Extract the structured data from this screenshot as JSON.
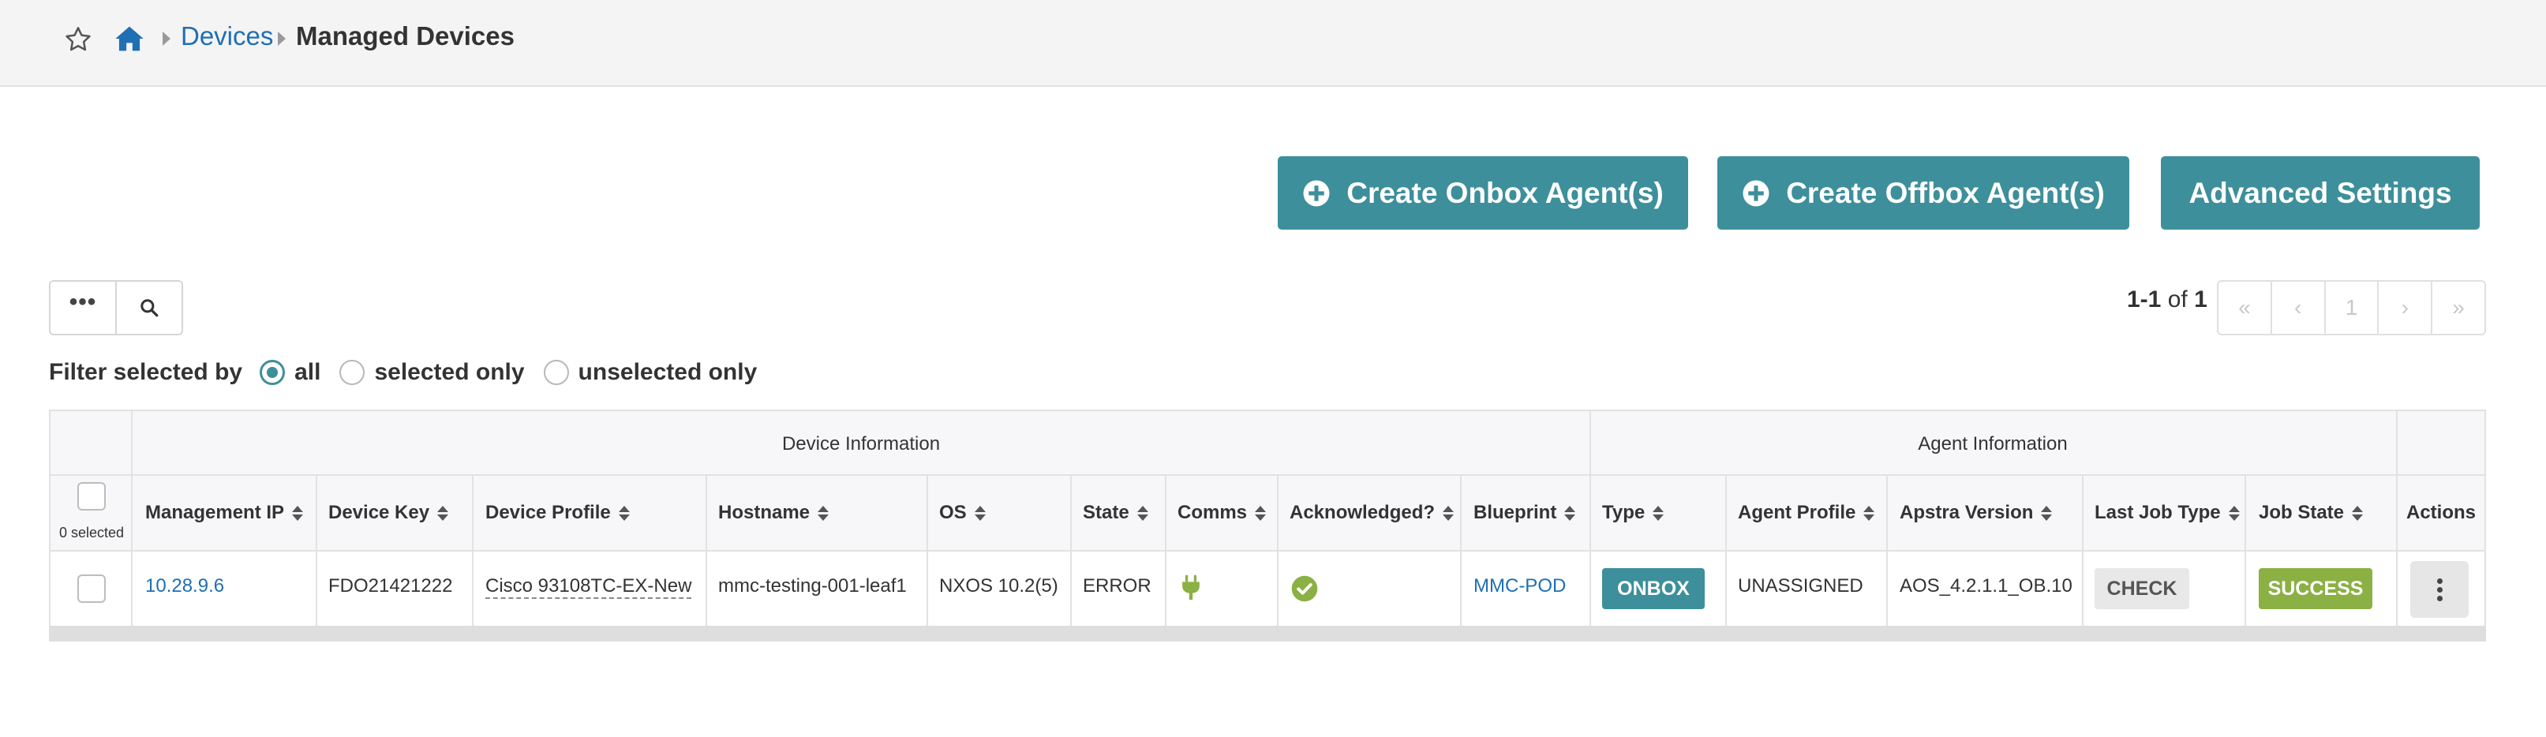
{
  "breadcrumb": {
    "devices": "Devices",
    "managed_devices": "Managed Devices"
  },
  "actions": {
    "create_onbox": "Create Onbox Agent(s)",
    "create_offbox": "Create Offbox Agent(s)",
    "advanced_settings": "Advanced Settings"
  },
  "toolbar": {
    "more": "•••"
  },
  "pagination": {
    "range": "1-1",
    "of": "of",
    "total": "1",
    "first": "«",
    "prev": "‹",
    "page": "1",
    "next": "›",
    "last": "»"
  },
  "filter": {
    "label": "Filter selected by",
    "options": [
      "all",
      "selected only",
      "unselected only"
    ],
    "selected": "all"
  },
  "table": {
    "groups": {
      "device_information": "Device Information",
      "agent_information": "Agent Information"
    },
    "selected_count": "0 selected",
    "columns": {
      "management_ip": "Management IP",
      "device_key": "Device Key",
      "device_profile": "Device Profile",
      "hostname": "Hostname",
      "os": "OS",
      "state": "State",
      "comms": "Comms",
      "acknowledged": "Acknowledged?",
      "blueprint": "Blueprint",
      "type": "Type",
      "agent_profile": "Agent Profile",
      "apstra_version": "Apstra Version",
      "last_job_type": "Last Job Type",
      "job_state": "Job State",
      "actions": "Actions"
    },
    "rows": [
      {
        "management_ip": "10.28.9.6",
        "device_key": "FDO21421222",
        "device_profile": "Cisco 93108TC-EX-New",
        "hostname": "mmc-testing-001-leaf1",
        "os": "NXOS 10.2(5)",
        "state": "ERROR",
        "comms_icon": "plug-icon",
        "acknowledged_icon": "check-circle-icon",
        "blueprint": "MMC-POD",
        "type": "ONBOX",
        "agent_profile": "UNASSIGNED",
        "apstra_version": "AOS_4.2.1.1_OB.10",
        "last_job_type": "CHECK",
        "job_state": "SUCCESS"
      }
    ]
  },
  "colors": {
    "accent": "#3d8f9b",
    "link": "#1f6fb3",
    "success": "#8bb044",
    "comms_ok": "#8bb044"
  }
}
